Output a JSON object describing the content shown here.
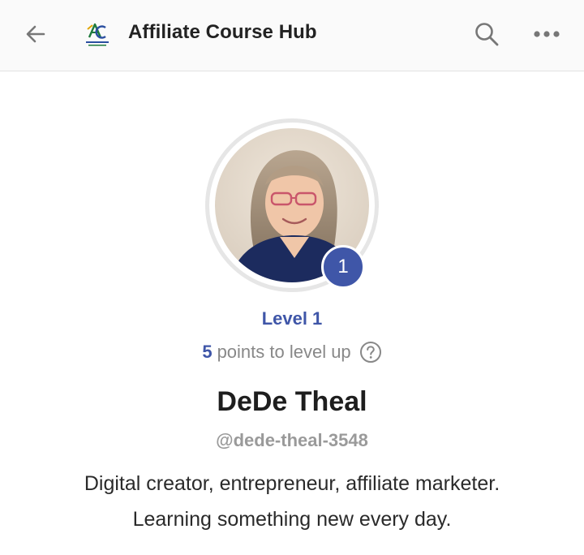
{
  "header": {
    "back_icon": "arrow-left-icon",
    "title": "Affiliate Course Hub",
    "search_icon": "search-icon",
    "more_icon": "more-horizontal-icon"
  },
  "profile": {
    "level_badge": "1",
    "level_label": "Level 1",
    "points": "5",
    "points_text": "points to level up",
    "help_icon": "question-circle-icon",
    "name": "DeDe Theal",
    "handle": "@dede-theal-3548",
    "bio_line1": "Digital creator, entrepreneur, affiliate marketer.",
    "bio_line2": "Learning something new every day."
  },
  "colors": {
    "accent": "#3f56a8",
    "muted_text": "#888888",
    "divider": "#e2e2e2"
  }
}
